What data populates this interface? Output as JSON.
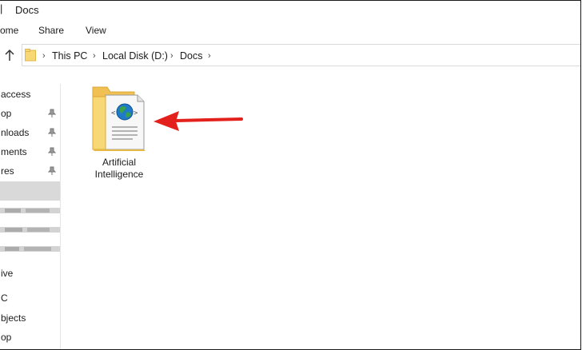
{
  "window": {
    "title_separator": "|",
    "title": "Docs"
  },
  "ribbon": {
    "tabs": [
      "ome",
      "Share",
      "View"
    ]
  },
  "address": {
    "crumbs": [
      "This PC",
      "Local Disk (D:)",
      "Docs"
    ]
  },
  "nav": {
    "items": [
      {
        "label": "access",
        "pinned": false
      },
      {
        "label": "op",
        "pinned": true
      },
      {
        "label": "nloads",
        "pinned": true
      },
      {
        "label": "ments",
        "pinned": true
      },
      {
        "label": "res",
        "pinned": true
      },
      {
        "label": "",
        "pinned": false,
        "selected": true
      },
      {
        "label": "",
        "blurred": true
      },
      {
        "label": "",
        "blurred": true
      },
      {
        "label": "",
        "blurred": true
      },
      {
        "label": "ive",
        "pinned": false
      },
      {
        "label": "C",
        "pinned": false
      },
      {
        "label": "bjects",
        "pinned": false
      },
      {
        "label": "op",
        "pinned": false
      }
    ]
  },
  "content": {
    "file": {
      "name": "Artificial Intelligence",
      "icon": "folder-with-html-document-icon"
    }
  },
  "colors": {
    "folder": "#f5c85a",
    "arrow": "#e3201b",
    "selected": "#d9d9d9"
  }
}
